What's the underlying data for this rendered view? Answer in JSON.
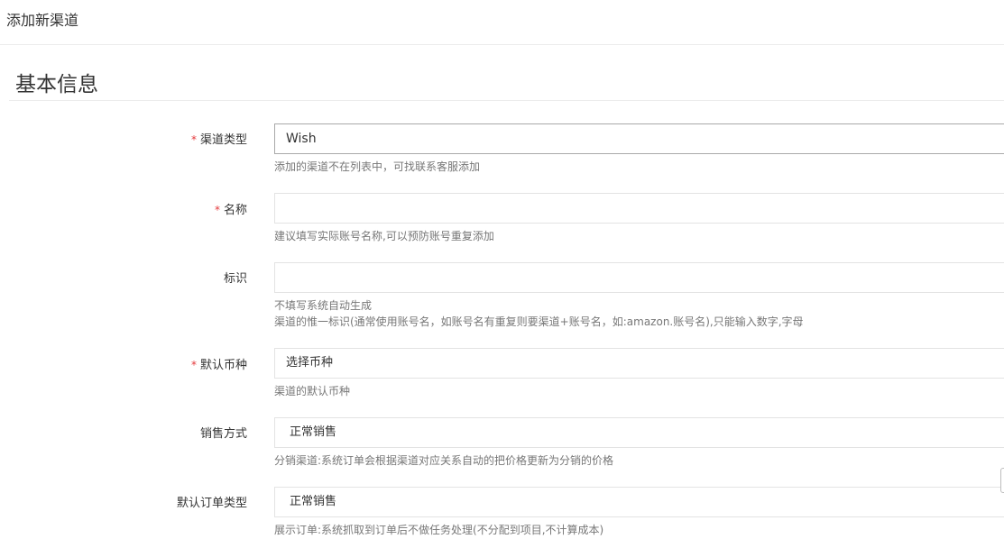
{
  "header": {
    "title": "添加新渠道"
  },
  "section": {
    "title": "基本信息"
  },
  "form": {
    "required_mark": "*",
    "channel_type": {
      "label": "渠道类型",
      "value": "Wish",
      "help": "添加的渠道不在列表中，可找联系客服添加"
    },
    "name": {
      "label": "名称",
      "value": "",
      "help": "建议填写实际账号名称,可以预防账号重复添加"
    },
    "identifier": {
      "label": "标识",
      "value": "",
      "help_line1": "不填写系统自动生成",
      "help_line2": "渠道的惟一标识(通常使用账号名，如账号名有重复则要渠道+账号名，如:amazon.账号名),只能输入数字,字母"
    },
    "default_currency": {
      "label": "默认币种",
      "value": "选择币种",
      "help": "渠道的默认币种"
    },
    "sales_mode": {
      "label": "销售方式",
      "value": "正常销售",
      "help": "分销渠道:系统订单会根据渠道对应关系自动的把价格更新为分销的价格"
    },
    "default_order_type": {
      "label": "默认订单类型",
      "value": "正常销售",
      "help": "展示订单:系统抓取到订单后不做任务处理(不分配到项目,不计算成本)"
    }
  }
}
